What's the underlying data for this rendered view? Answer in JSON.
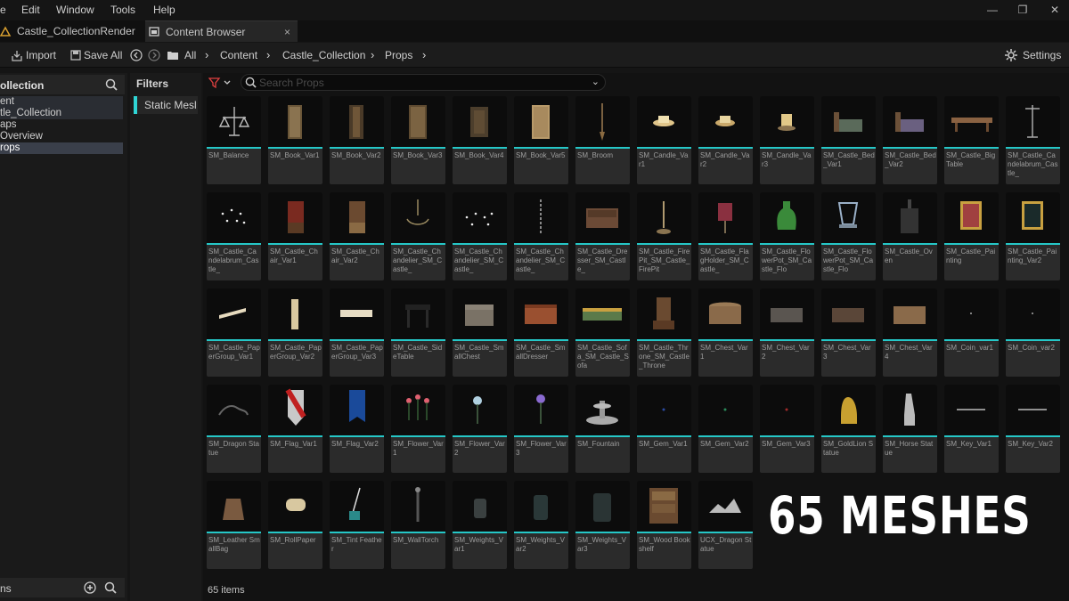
{
  "menu": [
    "e",
    "Edit",
    "Window",
    "Tools",
    "Help"
  ],
  "window_controls": [
    "—",
    "❐",
    "✕"
  ],
  "tabs": [
    {
      "label": "Castle_CollectionRender"
    },
    {
      "label": "Content Browser",
      "close": "×"
    }
  ],
  "toolbar": {
    "import_label": "Import",
    "save_all_label": "Save All",
    "breadcrumb": [
      "All",
      "Content",
      "Castle_Collection",
      "Props"
    ],
    "settings_label": "Settings"
  },
  "left_panel": {
    "title": "ollection",
    "tree": [
      "ent",
      "tle_Collection",
      "aps",
      "Overview",
      "rops"
    ],
    "footer_label": "ns"
  },
  "filters": {
    "title": "Filters",
    "chip": "Static Mesl"
  },
  "search": {
    "placeholder": "Search Props"
  },
  "assets": [
    "SM_Balance",
    "SM_Book_Var1",
    "SM_Book_Var2",
    "SM_Book_Var3",
    "SM_Book_Var4",
    "SM_Book_Var5",
    "SM_Broom",
    "SM_Candle_Var1",
    "SM_Candle_Var2",
    "SM_Candle_Var3",
    "SM_Castle_Bed_Var1",
    "SM_Castle_Bed_Var2",
    "SM_Castle_BigTable",
    "SM_Castle_Candelabrum_Castle_",
    "SM_Castle_Candelabrum_Castle_",
    "SM_Castle_Chair_Var1",
    "SM_Castle_Chair_Var2",
    "SM_Castle_Chandelier_SM_Castle_",
    "SM_Castle_Chandelier_SM_Castle_",
    "SM_Castle_Chandelier_SM_Castle_",
    "SM_Castle_Dresser_SM_Castle_",
    "SM_Castle_FirePit_SM_Castle_FirePit",
    "SM_Castle_FlagHolder_SM_Castle_",
    "SM_Castle_FlowerPot_SM_Castle_Flo",
    "SM_Castle_FlowerPot_SM_Castle_Flo",
    "SM_Castle_Oven",
    "SM_Castle_Painting",
    "SM_Castle_Painting_Var2",
    "SM_Castle_PaperGroup_Var1",
    "SM_Castle_PaperGroup_Var2",
    "SM_Castle_PaperGroup_Var3",
    "SM_Castle_SideTable",
    "SM_Castle_SmallChest",
    "SM_Castle_SmallDresser",
    "SM_Castle_Sofa_SM_Castle_Sofa",
    "SM_Castle_Throne_SM_Castle_Throne",
    "SM_Chest_Var1",
    "SM_Chest_Var2",
    "SM_Chest_Var3",
    "SM_Chest_Var4",
    "SM_Coin_var1",
    "SM_Coin_var2",
    "SM_Dragon Statue",
    "SM_Flag_Var1",
    "SM_Flag_Var2",
    "SM_Flower_Var1",
    "SM_Flower_Var2",
    "SM_Flower_Var3",
    "SM_Fountain",
    "SM_Gem_Var1",
    "SM_Gem_Var2",
    "SM_Gem_Var3",
    "SM_GoldLion Statue",
    "SM_Horse Statue",
    "SM_Key_Var1",
    "SM_Key_Var2",
    "SM_Leather SmallBag",
    "SM_RollPaper",
    "SM_Tint Feather",
    "SM_WallTorch",
    "SM_Weights_Var1",
    "SM_Weights_Var2",
    "SM_Weights_Var3",
    "SM_Wood Bookshelf",
    "UCX_Dragon Statue"
  ],
  "item_count": "65 items",
  "overlay_text": "65 MESHES",
  "colors": {
    "accent": "#25c7c7",
    "filter_chip": "#2fd5d5"
  }
}
